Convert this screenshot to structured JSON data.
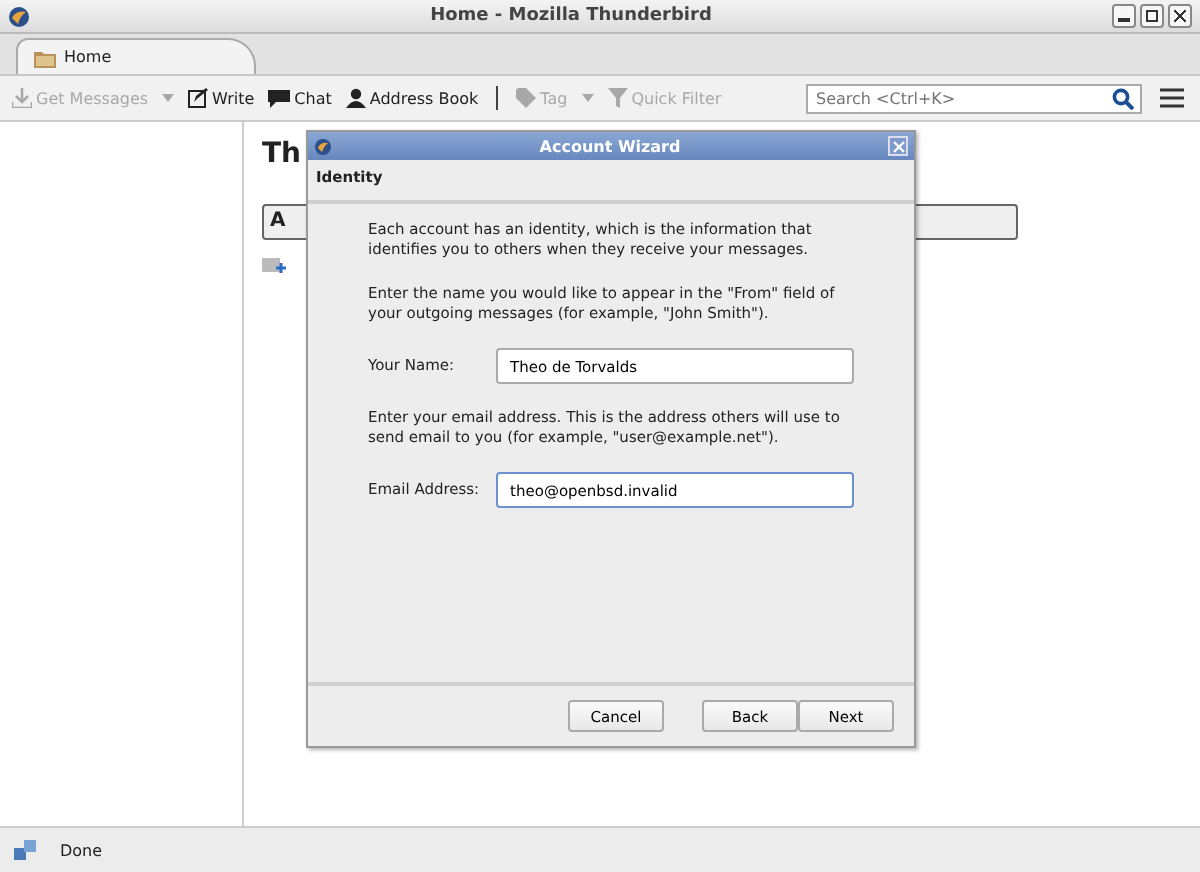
{
  "window": {
    "title": "Home - Mozilla Thunderbird"
  },
  "tabs": [
    {
      "label": "Home",
      "selected": true
    }
  ],
  "toolbar": [
    {
      "label": "Get Messages",
      "kind": "download",
      "disabled": true,
      "dropdown": true
    },
    {
      "label": "Write",
      "kind": "write",
      "disabled": false,
      "dropdown": false
    },
    {
      "label": "Chat",
      "kind": "chat",
      "disabled": false,
      "dropdown": false
    },
    {
      "label": "Address Book",
      "kind": "person",
      "disabled": false,
      "dropdown": false
    },
    {
      "label": "Tag",
      "kind": "tag",
      "disabled": true,
      "dropdown": true
    },
    {
      "label": "Quick Filter",
      "kind": "filter",
      "disabled": true,
      "dropdown": false
    }
  ],
  "search": {
    "placeholder": "Search <Ctrl+K>"
  },
  "content": {
    "heading": "Th",
    "box_text": "A"
  },
  "dialog": {
    "title": "Account Wizard",
    "section": "Identity",
    "intro": "Each account has an identity, which is the information that identifies you to others when they receive your messages.",
    "name_hint": "Enter the name you would like to appear in the \"From\" field of your outgoing messages (for example, \"John Smith\").",
    "name_label": "Your Name:",
    "name_value": "Theo de Torvalds",
    "email_hint": "Enter your email address. This is the address others will use to send email to you (for example, \"user@example.net\").",
    "email_label": "Email Address:",
    "email_value": "theo@openbsd.invalid",
    "buttons": [
      "Cancel",
      "Back",
      "Next"
    ]
  },
  "status_bar": {
    "text": "Done"
  }
}
